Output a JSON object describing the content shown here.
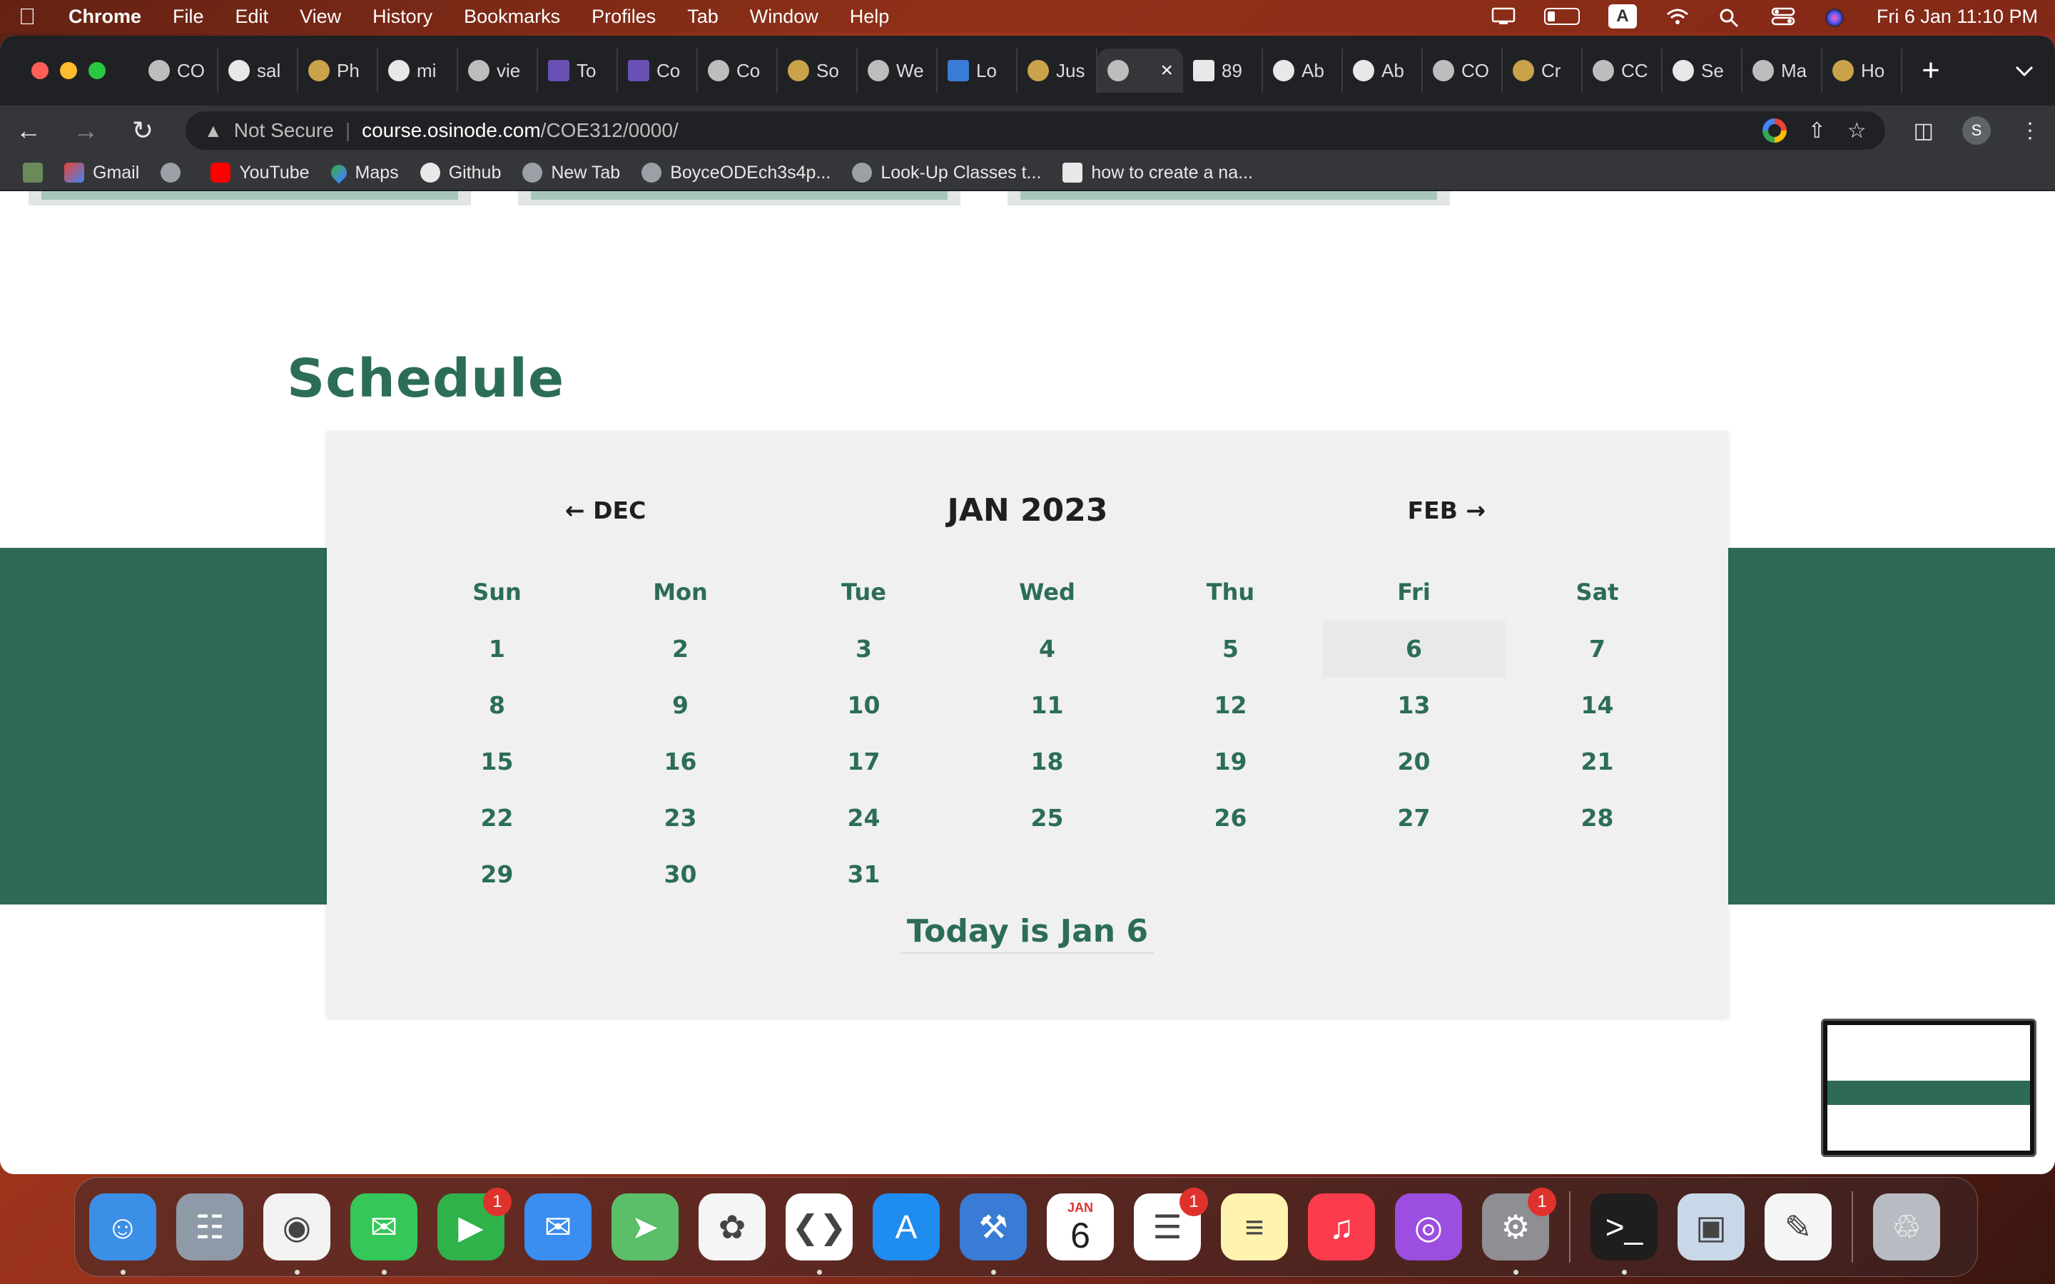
{
  "menubar": {
    "app_name": "Chrome",
    "items": [
      "File",
      "Edit",
      "View",
      "History",
      "Bookmarks",
      "Profiles",
      "Tab",
      "Window",
      "Help"
    ],
    "input_source": "A",
    "clock": "Fri 6 Jan  11:10 PM"
  },
  "tabs": [
    {
      "label": "CO",
      "icon": "globe-icon"
    },
    {
      "label": "sal",
      "icon": "github-icon"
    },
    {
      "label": "Ph",
      "icon": "site-icon"
    },
    {
      "label": "mi",
      "icon": "google-icon"
    },
    {
      "label": "vie",
      "icon": "globe-icon"
    },
    {
      "label": "To",
      "icon": "colorlib-icon"
    },
    {
      "label": "Co",
      "icon": "colorlib-icon"
    },
    {
      "label": "Co",
      "icon": "globe-icon"
    },
    {
      "label": "So",
      "icon": "site-icon"
    },
    {
      "label": "We",
      "icon": "globe-icon"
    },
    {
      "label": "Lo",
      "icon": "w3schools-icon"
    },
    {
      "label": "Jus",
      "icon": "site-icon"
    },
    {
      "label": "",
      "icon": "globe-icon",
      "active": true
    },
    {
      "label": "89",
      "icon": "f-icon"
    },
    {
      "label": "Ab",
      "icon": "codepen-icon"
    },
    {
      "label": "Ab",
      "icon": "codepen-icon"
    },
    {
      "label": "CO",
      "icon": "globe-icon"
    },
    {
      "label": "Cr",
      "icon": "site-icon"
    },
    {
      "label": "CC",
      "icon": "globe-icon"
    },
    {
      "label": "Se",
      "icon": "gear-icon"
    },
    {
      "label": "Ma",
      "icon": "globe-icon"
    },
    {
      "label": "Ho",
      "icon": "site-icon"
    }
  ],
  "omnibox": {
    "security": "Not Secure",
    "host": "course.osinode.com",
    "path": "/COE312/0000/"
  },
  "profile_initial": "S",
  "bookmarks": [
    {
      "label": "Gmail",
      "icon": "gmail-icon"
    },
    {
      "label": "",
      "icon": "globe-icon"
    },
    {
      "label": "YouTube",
      "icon": "youtube-icon"
    },
    {
      "label": "Maps",
      "icon": "maps-icon"
    },
    {
      "label": "Github",
      "icon": "github-icon"
    },
    {
      "label": "New Tab",
      "icon": "globe-icon"
    },
    {
      "label": "BoyceODEch3s4p...",
      "icon": "globe-icon"
    },
    {
      "label": "Look-Up Classes t...",
      "icon": "globe-icon"
    },
    {
      "label": "how to create a na...",
      "icon": "codepen-icon"
    }
  ],
  "page": {
    "section_title": "Schedule",
    "calendar": {
      "prev_label": "← DEC",
      "next_label": "FEB →",
      "month_title": "JAN 2023",
      "weekdays": [
        "Sun",
        "Mon",
        "Tue",
        "Wed",
        "Thu",
        "Fri",
        "Sat"
      ],
      "weeks": [
        [
          "1",
          "2",
          "3",
          "4",
          "5",
          "6",
          "7"
        ],
        [
          "8",
          "9",
          "10",
          "11",
          "12",
          "13",
          "14"
        ],
        [
          "15",
          "16",
          "17",
          "18",
          "19",
          "20",
          "21"
        ],
        [
          "22",
          "23",
          "24",
          "25",
          "26",
          "27",
          "28"
        ],
        [
          "29",
          "30",
          "31",
          "",
          "",
          "",
          ""
        ]
      ],
      "today_day": "6",
      "today_label": "Today is Jan 6"
    }
  },
  "dock": {
    "apps": [
      {
        "name": "finder",
        "color": "#3b8fe6",
        "running": true
      },
      {
        "name": "launchpad",
        "color": "#8e9aa8"
      },
      {
        "name": "chrome",
        "color": "#f2f2f2",
        "running": true
      },
      {
        "name": "messages",
        "color": "#35c759",
        "running": true
      },
      {
        "name": "facetime",
        "color": "#2fb24a",
        "badge": "1"
      },
      {
        "name": "mail",
        "color": "#3a8ef0"
      },
      {
        "name": "maps",
        "color": "#5bbf6a"
      },
      {
        "name": "photos",
        "color": "#f5f5f5"
      },
      {
        "name": "vscode",
        "color": "#ffffff",
        "running": true
      },
      {
        "name": "app-store",
        "color": "#1f8cf0"
      },
      {
        "name": "xcode",
        "color": "#3a7bd5",
        "running": true
      },
      {
        "name": "calendar",
        "color": "#ffffff",
        "month": "JAN",
        "day": "6"
      },
      {
        "name": "reminders",
        "color": "#ffffff",
        "badge": "1"
      },
      {
        "name": "notes",
        "color": "#fff3b0"
      },
      {
        "name": "music",
        "color": "#fa3c4c"
      },
      {
        "name": "podcasts",
        "color": "#9b4ee0"
      },
      {
        "name": "system-settings",
        "color": "#8e8e93",
        "badge": "1",
        "running": true
      },
      {
        "name": "terminal",
        "color": "#1e1e1e",
        "running": true,
        "separator_before": true
      },
      {
        "name": "preview",
        "color": "#c8d8e8"
      },
      {
        "name": "textedit",
        "color": "#f5f5f5"
      },
      {
        "name": "trash",
        "color": "#b8bcc2",
        "separator_before": true
      }
    ]
  }
}
